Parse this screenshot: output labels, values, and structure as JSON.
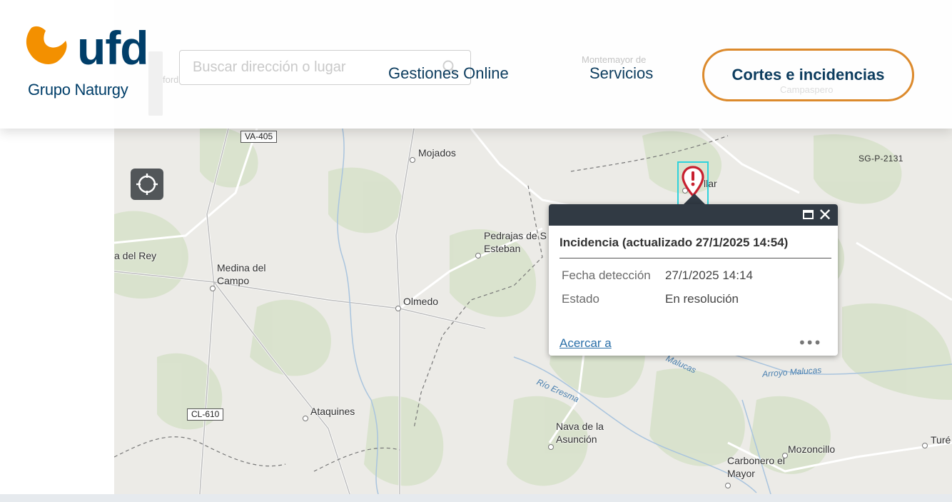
{
  "header": {
    "logo_word": "ufd",
    "logo_sub": "Grupo Naturgy",
    "search_placeholder": "Buscar dirección o lugar",
    "nav": {
      "gestiones": "Gestiones Online",
      "servicios": "Servicios",
      "cortes": "Cortes e incidencias"
    }
  },
  "map": {
    "towns": [
      {
        "name": "Mojados"
      },
      {
        "name": "Pedrajas de S\nEsteban"
      },
      {
        "name": "a del Rey"
      },
      {
        "name": "Medina del\nCampo"
      },
      {
        "name": "Olmedo"
      },
      {
        "name": "Ataquines"
      },
      {
        "name": "Nava de la\nAsunción"
      },
      {
        "name": "Carbonero el\nMayor"
      },
      {
        "name": "Mozoncillo"
      },
      {
        "name": "Turé"
      },
      {
        "name": "llar"
      }
    ],
    "road_shields": [
      "VA-405",
      "CL-610"
    ],
    "road_labels": [
      "SG-P-2131"
    ],
    "water_labels": [
      "Río Eresma",
      "Arroyo Malucas",
      "Malucas"
    ],
    "ghost_labels": [
      "Montemayor de",
      "Campaspero",
      "ford"
    ]
  },
  "popup": {
    "title": "Incidencia (actualizado 27/1/2025 14:54)",
    "fields": [
      {
        "label": "Fecha detección",
        "value": "27/1/2025 14:14"
      },
      {
        "label": "Estado",
        "value": "En resolución"
      }
    ],
    "zoom_link": "Acercar a",
    "more": "•••",
    "close": "✕"
  },
  "colors": {
    "brand_blue": "#003e69",
    "brand_orange": "#f39000",
    "cta_border": "#dc8a2c",
    "marker_red": "#c8202f",
    "popup_header": "#313a44"
  },
  "icons": {
    "locate": "crosshair-icon",
    "search": "search-icon",
    "marker": "incident-marker-icon",
    "maximize": "maximize-icon",
    "close": "close-icon"
  }
}
